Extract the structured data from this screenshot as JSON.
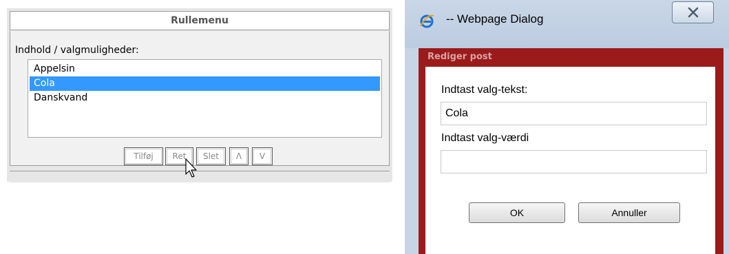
{
  "left_panel": {
    "title": "Rullemenu",
    "options_label": "Indhold / valgmuligheder:",
    "options": [
      {
        "label": "Appelsin",
        "selected": false
      },
      {
        "label": "Cola",
        "selected": true
      },
      {
        "label": "Danskvand",
        "selected": false
      }
    ],
    "buttons": {
      "add": "Tilføj",
      "edit": "Ret",
      "delete": "Slet",
      "up": "Λ",
      "down": "V"
    }
  },
  "dialog": {
    "window_title": "-- Webpage Dialog",
    "panel_title": "Rediger post",
    "text_label": "Indtast valg-tekst:",
    "text_value": "Cola",
    "value_label": "Indtast valg-værdi",
    "value_value": "",
    "ok_label": "OK",
    "cancel_label": "Annuller"
  },
  "colors": {
    "selection": "#3399ff",
    "dialog_frame": "#9b1b1b",
    "titlebar": "#c7d6e6"
  },
  "icons": [
    "ie-icon",
    "close-icon",
    "mouse-pointer-icon"
  ]
}
